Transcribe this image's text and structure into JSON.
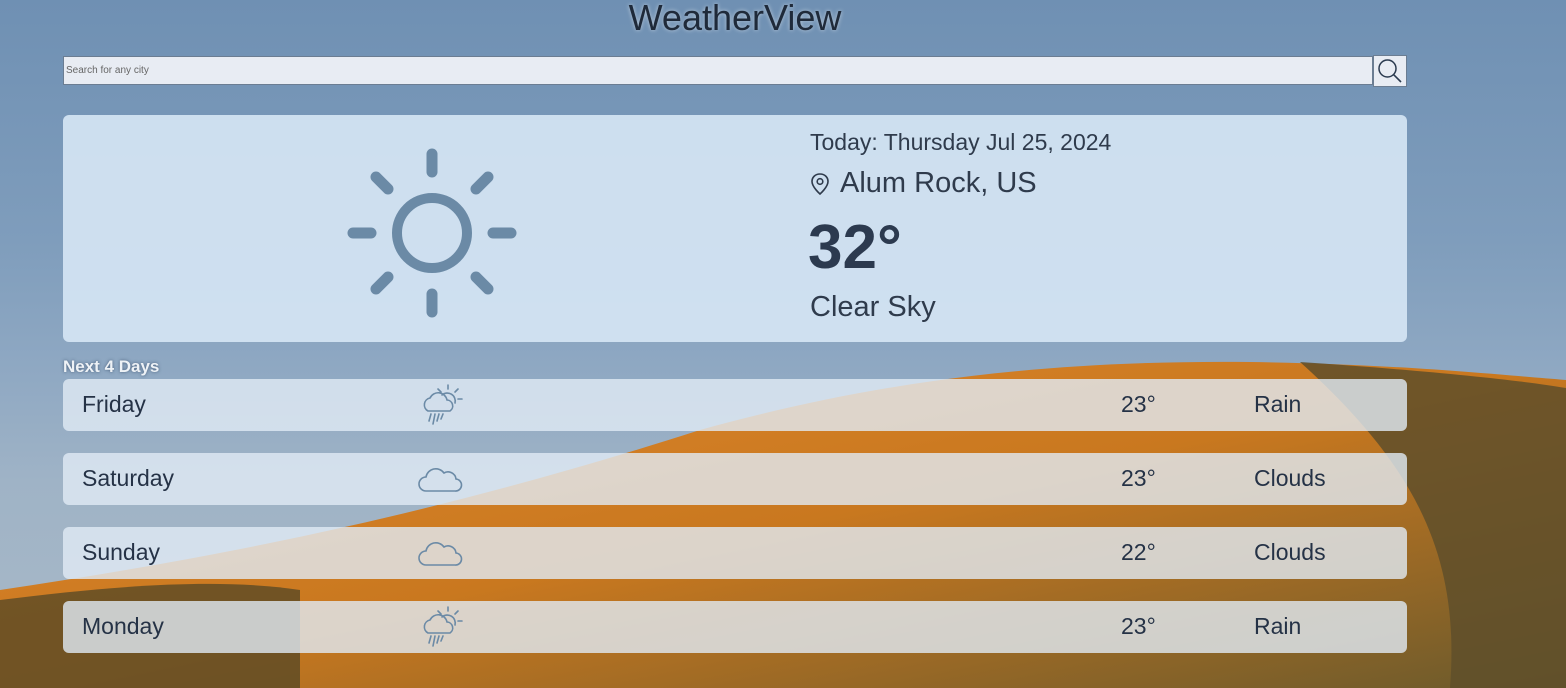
{
  "app": {
    "title": "WeatherView"
  },
  "search": {
    "placeholder": "Search for any city",
    "icon": "search-icon"
  },
  "current": {
    "date_text": "Today: Thursday Jul 25, 2024",
    "location": "Alum Rock, US",
    "temperature": "32°",
    "condition": "Clear Sky",
    "icon": "sun-icon"
  },
  "forecast": {
    "heading": "Next 4 Days",
    "days": [
      {
        "day": "Friday",
        "temp": "23°",
        "condition": "Rain",
        "icon": "rain-cloud-sun-icon"
      },
      {
        "day": "Saturday",
        "temp": "23°",
        "condition": "Clouds",
        "icon": "cloud-icon"
      },
      {
        "day": "Sunday",
        "temp": "22°",
        "condition": "Clouds",
        "icon": "cloud-icon"
      },
      {
        "day": "Monday",
        "temp": "23°",
        "condition": "Rain",
        "icon": "rain-cloud-sun-icon"
      }
    ]
  },
  "colors": {
    "icon_blue": "#6b8aa6",
    "card_bg": "#d4e4f3",
    "text_dark": "#253246"
  }
}
